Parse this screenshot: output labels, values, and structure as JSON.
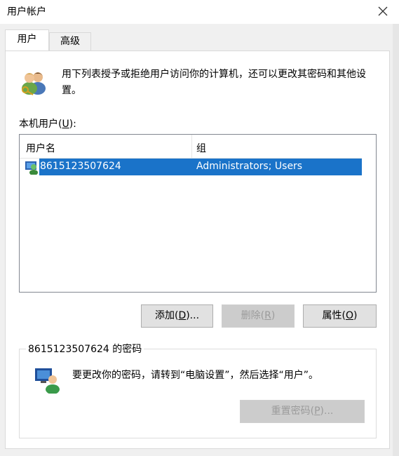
{
  "window": {
    "title": "用户帐户"
  },
  "tabs": [
    {
      "label": "用户",
      "active": true
    },
    {
      "label": "高级",
      "active": false
    }
  ],
  "intro": {
    "text": "用下列表授予或拒绝用户访问你的计算机，还可以更改其密码和其他设置。"
  },
  "users_section": {
    "label_pre": "本机用户(",
    "label_key": "U",
    "label_post": "):"
  },
  "list": {
    "columns": [
      "用户名",
      "组"
    ],
    "rows": [
      {
        "username": "8615123507624",
        "groups": "Administrators; Users",
        "selected": true
      }
    ]
  },
  "buttons": {
    "add": {
      "pre": "添加(",
      "key": "D",
      "post": ")...",
      "enabled": true
    },
    "remove": {
      "pre": "删除(",
      "key": "R",
      "post": ")",
      "enabled": false
    },
    "properties": {
      "pre": "属性(",
      "key": "O",
      "post": ")",
      "enabled": true
    },
    "reset": {
      "pre": "重置密码(",
      "key": "P",
      "post": ")...",
      "enabled": false
    }
  },
  "password_group": {
    "title": "8615123507624 的密码",
    "text": "要更改你的密码，请转到“电脑设置”，然后选择“用户”。"
  },
  "colors": {
    "selection": "#1a73c9",
    "panel": "#ffffff",
    "window": "#f0f0f0"
  }
}
